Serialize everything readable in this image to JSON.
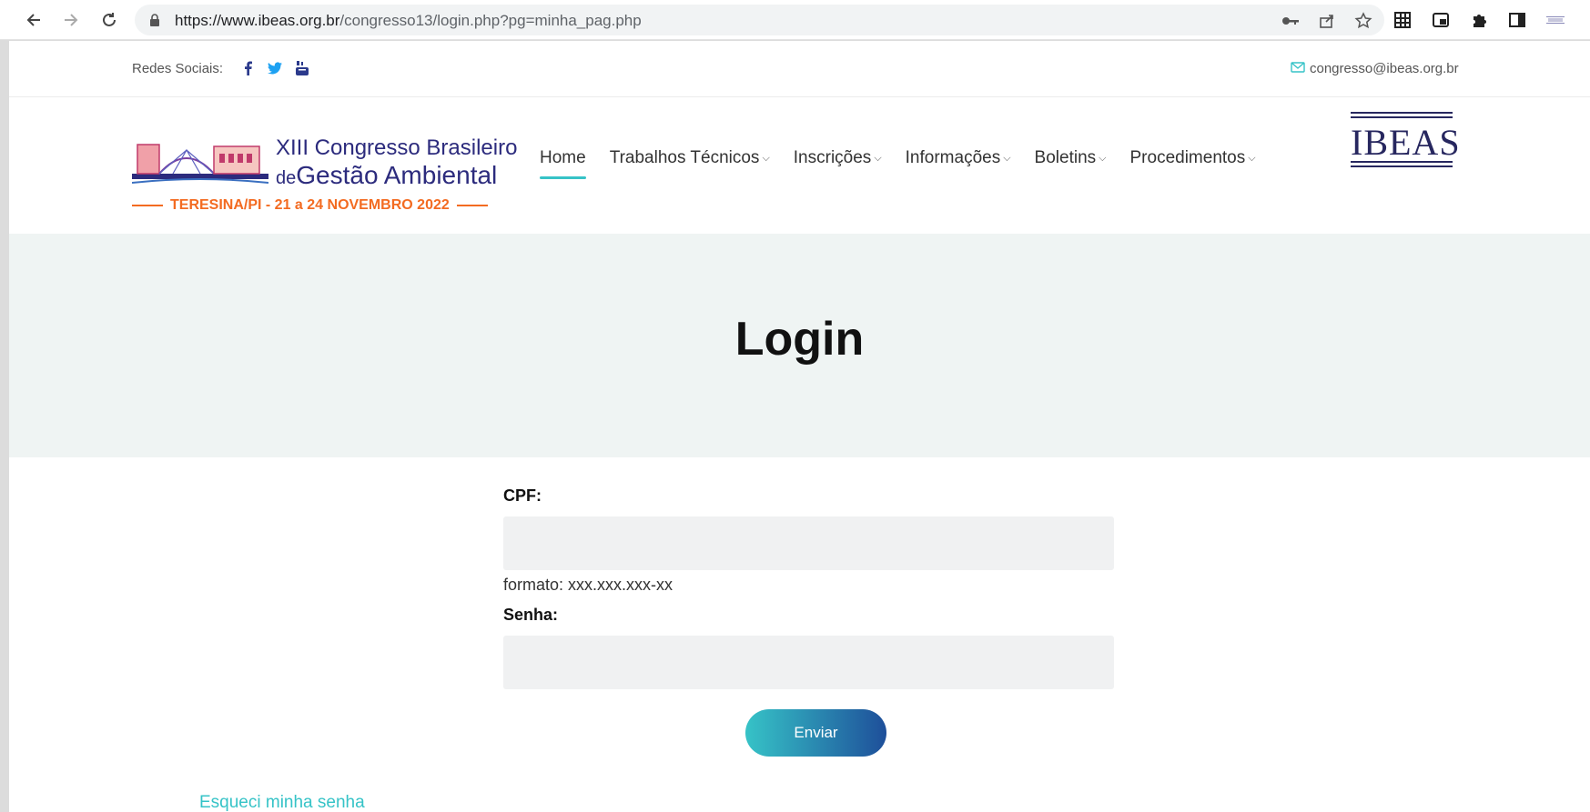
{
  "browser": {
    "url_host": "https://www.ibeas.org.br",
    "url_path": "/congresso13/login.php?pg=minha_pag.php"
  },
  "topbar": {
    "social_label": "Redes Sociais:",
    "email": "congresso@ibeas.org.br"
  },
  "logo": {
    "line1": "XIII Congresso Brasileiro",
    "line2_prefix": "de",
    "line2": "Gestão Ambiental",
    "subline": "TERESINA/PI - 21 a 24 NOVEMBRO 2022"
  },
  "menu": [
    {
      "label": "Home"
    },
    {
      "label": "Trabalhos Técnicos"
    },
    {
      "label": "Inscrições"
    },
    {
      "label": "Informações"
    },
    {
      "label": "Boletins"
    },
    {
      "label": "Procedimentos"
    }
  ],
  "org_logo": "IBEAS",
  "hero": {
    "title": "Login"
  },
  "form": {
    "cpf_label": "CPF:",
    "cpf_value": "",
    "cpf_hint": "formato: xxx.xxx.xxx-xx",
    "password_label": "Senha:",
    "password_value": "",
    "submit_label": "Enviar"
  },
  "forgot_link": "Esqueci minha senha",
  "colors": {
    "accent": "#36c3c7",
    "brand_dark": "#2c2b7d",
    "brand_orange": "#f36b21",
    "button_gradient_end": "#1e4f9a"
  }
}
